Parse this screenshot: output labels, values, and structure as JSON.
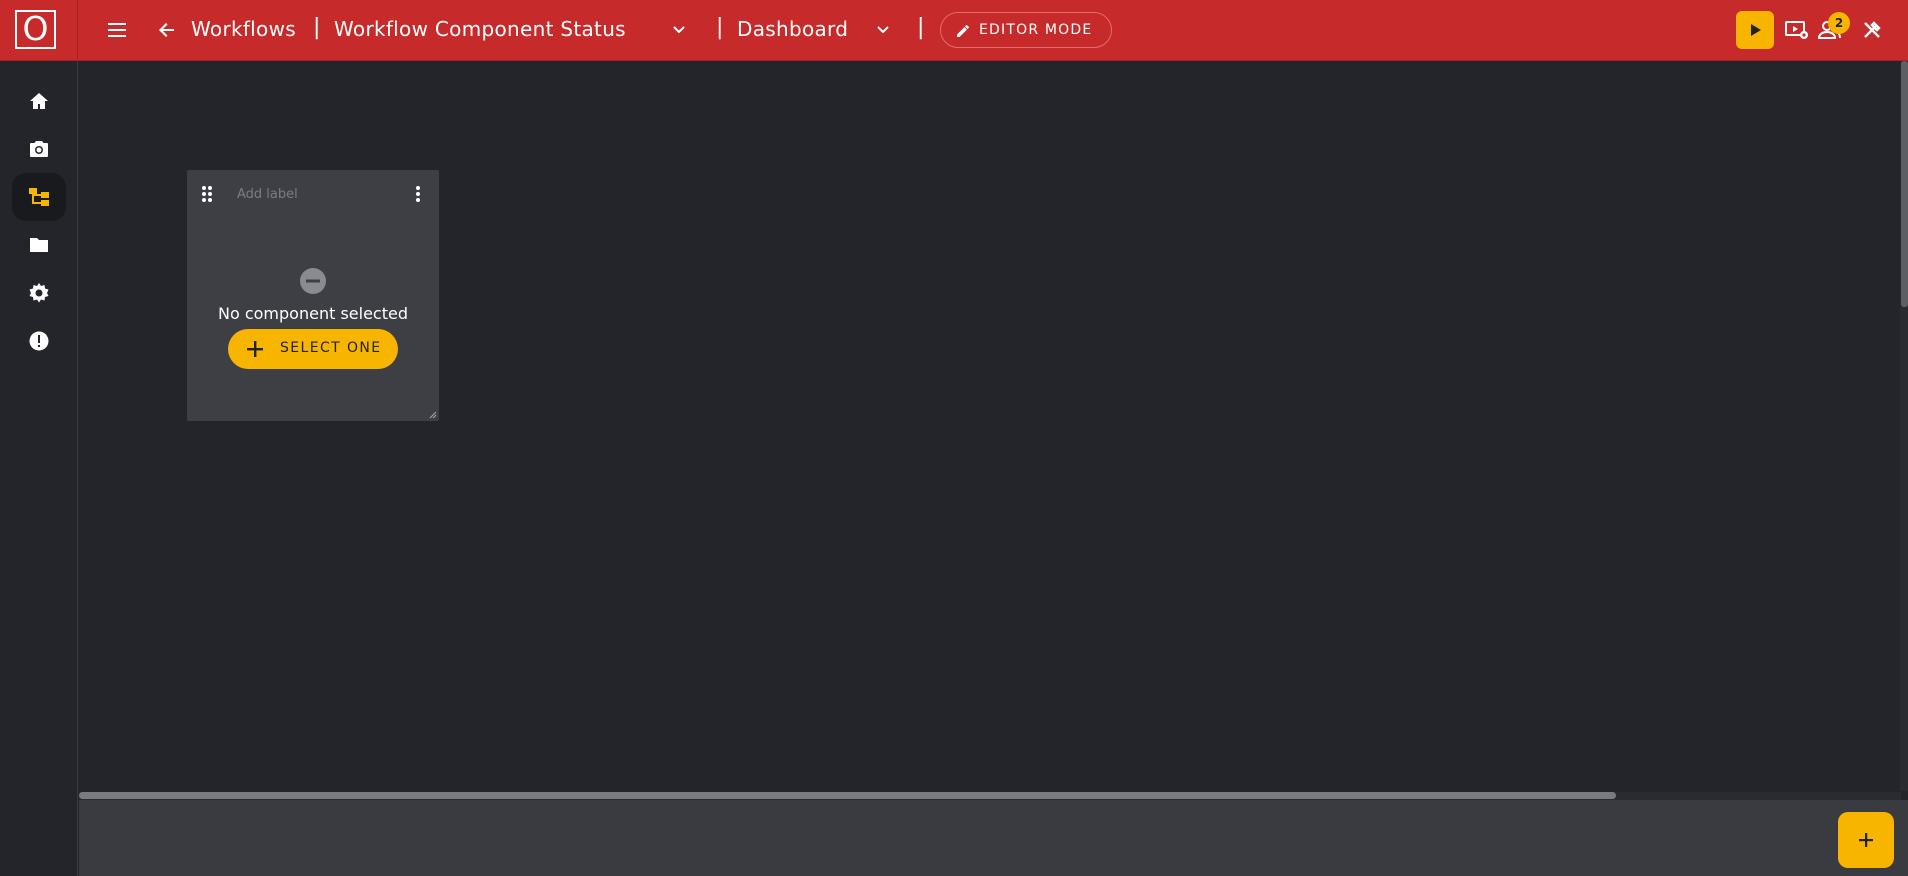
{
  "app": {
    "logo_letter": "O",
    "accent": "#f7b500",
    "header_color": "#c62a2a"
  },
  "topbar": {
    "menu_icon": "hamburger-icon",
    "back_icon": "arrow-left-icon",
    "breadcrumb_root": "Workflows",
    "separator": "|",
    "workflow_name": "Workflow Component Status",
    "view_name": "Dashboard",
    "editor_mode_label": "EDITOR MODE",
    "notifications_count": "2",
    "right_icons": [
      "play-icon",
      "monitor-settings-icon",
      "users-icon",
      "tools-icon"
    ]
  },
  "sidebar": {
    "items": [
      {
        "name": "home",
        "icon": "home-icon"
      },
      {
        "name": "camera",
        "icon": "camera-icon"
      },
      {
        "name": "workflows",
        "icon": "workflow-tree-icon",
        "active": true
      },
      {
        "name": "files",
        "icon": "folder-icon"
      },
      {
        "name": "settings",
        "icon": "gear-icon"
      },
      {
        "name": "alerts",
        "icon": "alert-icon"
      }
    ]
  },
  "widget": {
    "label_placeholder": "Add label",
    "empty_text": "No component selected",
    "select_button": "SELECT ONE"
  },
  "fab": {
    "icon": "plus-icon"
  }
}
